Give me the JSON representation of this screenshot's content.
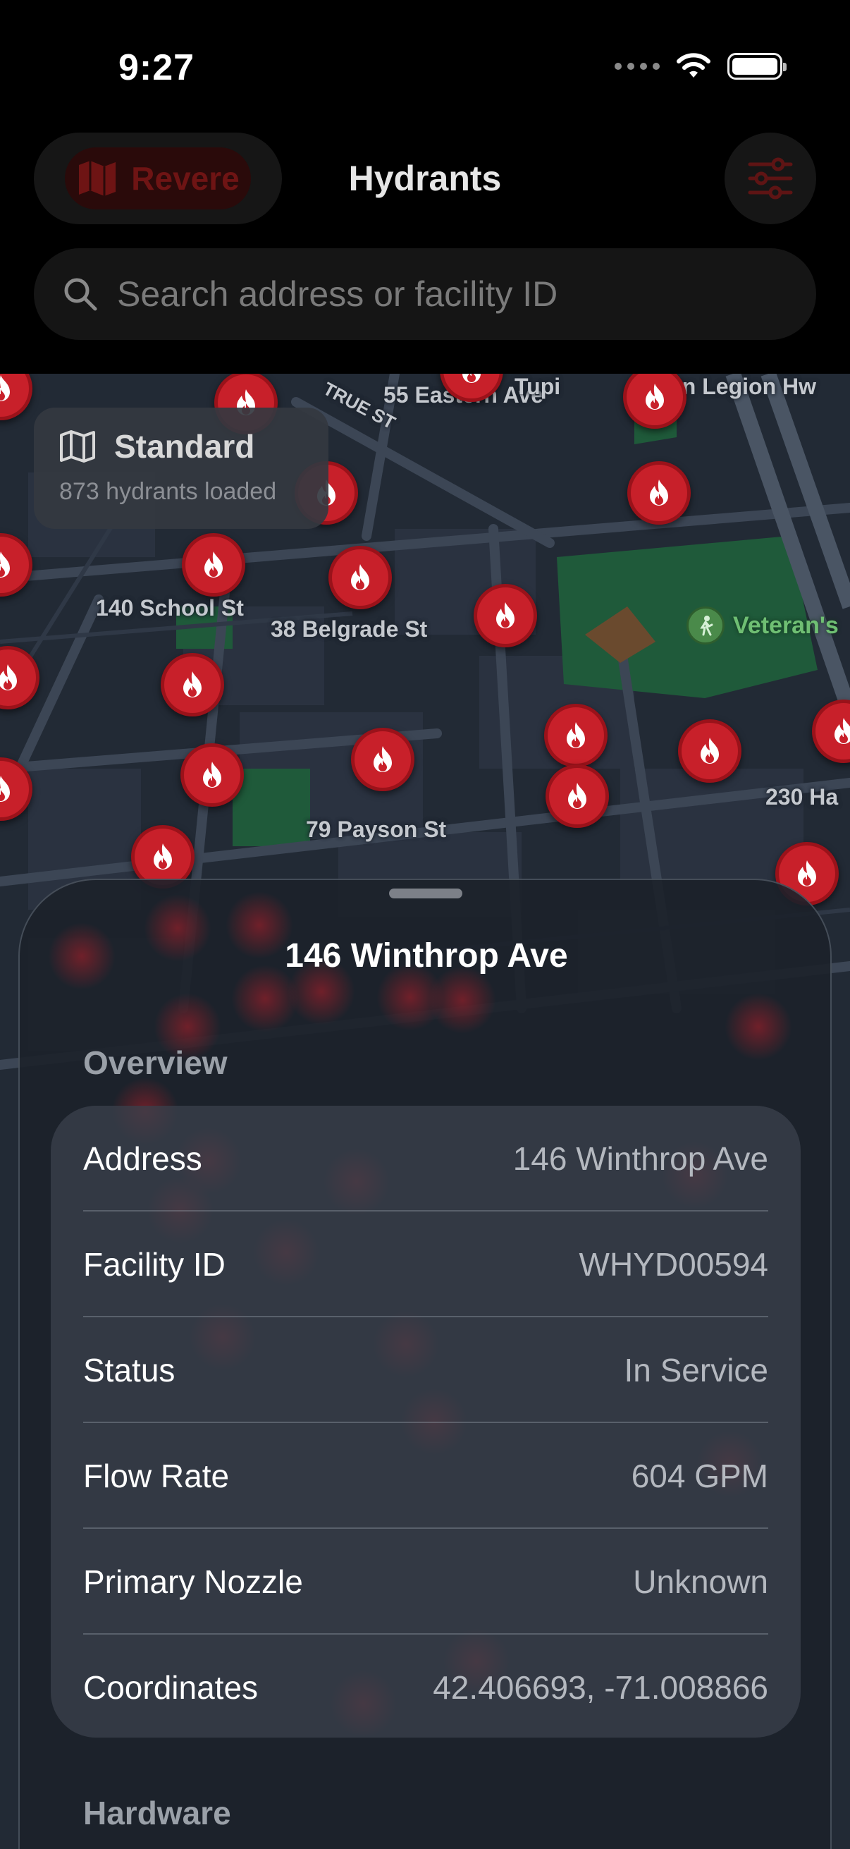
{
  "status_bar": {
    "time": "9:27"
  },
  "header": {
    "city_label": "Revere",
    "title": "Hydrants",
    "filter_icon": "sliders-icon"
  },
  "search": {
    "placeholder": "Search address or facility ID",
    "value": ""
  },
  "map": {
    "layer_name": "Standard",
    "hydrant_count_text": "873 hydrants loaded",
    "streets": [
      "55 Eastern Ave",
      "TRUE ST",
      "140 School St",
      "38 Belgrade St",
      "79 Payson St",
      "230 Ha",
      "an Legion Hw",
      "Tupi"
    ],
    "park_label": "Veteran's",
    "colors": {
      "hydrant": "#c8202a",
      "park": "#1f5a3a"
    }
  },
  "sheet": {
    "title": "146 Winthrop Ave",
    "overview_header": "Overview",
    "rows": [
      {
        "label": "Address",
        "value": "146 Winthrop Ave"
      },
      {
        "label": "Facility ID",
        "value": "WHYD00594"
      },
      {
        "label": "Status",
        "value": "In Service"
      },
      {
        "label": "Flow Rate",
        "value": "604 GPM"
      },
      {
        "label": "Primary Nozzle",
        "value": "Unknown"
      },
      {
        "label": "Coordinates",
        "value": "42.406693, -71.008866"
      }
    ],
    "hardware_header": "Hardware"
  }
}
